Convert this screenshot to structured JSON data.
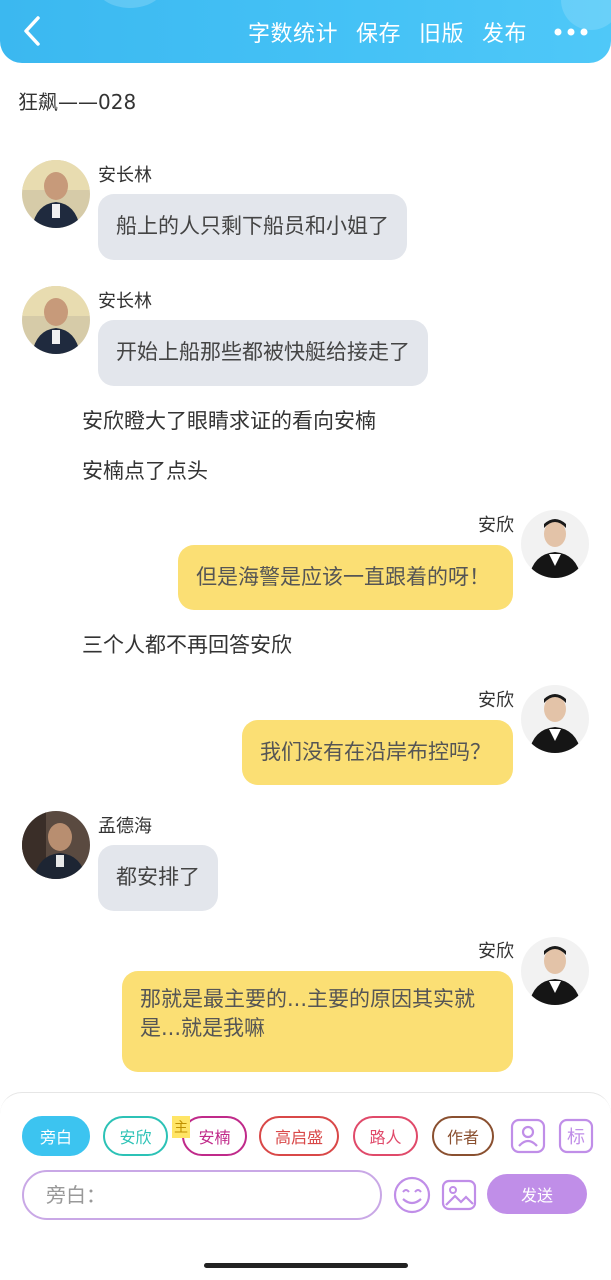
{
  "header": {
    "back_icon": "chevron-left-icon",
    "actions": [
      "字数统计",
      "保存",
      "旧版",
      "发布"
    ],
    "more_icon": "more-dots-icon",
    "colors": {
      "gradient_start": "#3bb8f0",
      "gradient_end": "#4fc8f8"
    }
  },
  "doc": {
    "title": "狂飙——028"
  },
  "messages": [
    {
      "type": "left",
      "name": "安长林",
      "text": "船上的人只剩下船员和小姐了"
    },
    {
      "type": "left",
      "name": "安长林",
      "text": "开始上船那些都被快艇给接走了"
    },
    {
      "type": "narration",
      "text": "安欣瞪大了眼睛求证的看向安楠"
    },
    {
      "type": "narration",
      "text": "安楠点了点头"
    },
    {
      "type": "right",
      "name": "安欣",
      "text": "但是海警是应该一直跟着的呀！"
    },
    {
      "type": "narration",
      "text": "三个人都不再回答安欣"
    },
    {
      "type": "right",
      "name": "安欣",
      "text": "我们没有在沿岸布控吗？"
    },
    {
      "type": "left",
      "name": "孟德海",
      "text": "都安排了"
    },
    {
      "type": "right",
      "name": "安欣",
      "text": "那就是最主要的...主要的原因其实就是...就是我嘛"
    }
  ],
  "toolbar": {
    "roles": [
      {
        "label": "旁白",
        "color": "#3cc4f0",
        "selected": true
      },
      {
        "label": "安欣",
        "color": "#2cc2b6",
        "selected": false
      },
      {
        "label": "安楠",
        "color": "#c02a8a",
        "selected": false
      },
      {
        "label": "高启盛",
        "color": "#d94848",
        "selected": false
      },
      {
        "label": "路人",
        "color": "#e04a6a",
        "selected": false
      },
      {
        "label": "作者",
        "color": "#8a5030",
        "selected": false
      }
    ],
    "main_tag": "主",
    "tools": [
      {
        "icon": "contact-card-icon"
      },
      {
        "icon": "tag-biao-icon",
        "label": "标"
      }
    ],
    "input_placeholder": "旁白：",
    "emoji_icon": "smiley-icon",
    "image_icon": "image-icon",
    "send_label": "发送",
    "accent": "#c08ee8"
  }
}
